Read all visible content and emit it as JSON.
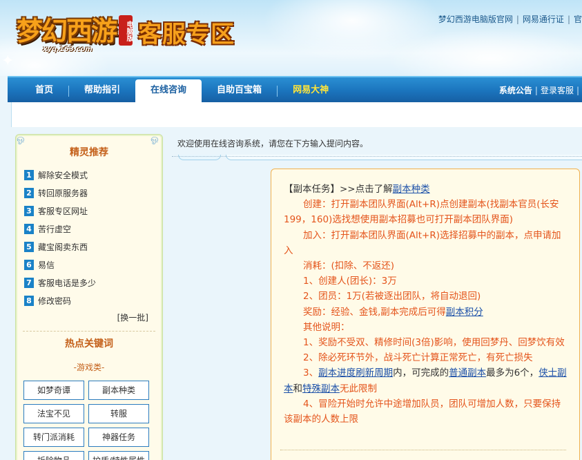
{
  "header": {
    "logo_game_text": "梦幻西游",
    "logo_edition": "电脑版",
    "logo_url": "xyq.163.com",
    "title": "客服专区",
    "top_links": [
      "梦幻西游电脑版官网",
      "网易通行证",
      "官"
    ]
  },
  "nav": {
    "items": [
      {
        "label": "首页"
      },
      {
        "label": "帮助指引"
      },
      {
        "label": "在线咨询"
      },
      {
        "label": "自助百宝箱"
      },
      {
        "label": "网易大神"
      }
    ],
    "right": {
      "announcement": "系统公告",
      "login": "登录客服",
      "more": "|"
    }
  },
  "sidebar": {
    "recommend_title": "精灵推荐",
    "recommend": [
      {
        "num": "1",
        "label": "解除安全模式"
      },
      {
        "num": "2",
        "label": "转回原服务器"
      },
      {
        "num": "3",
        "label": "客服专区网址"
      },
      {
        "num": "4",
        "label": "苦行虚空"
      },
      {
        "num": "5",
        "label": "藏宝阁卖东西"
      },
      {
        "num": "6",
        "label": "易信"
      },
      {
        "num": "7",
        "label": "客服电话是多少"
      },
      {
        "num": "8",
        "label": "修改密码"
      }
    ],
    "change_batch": "[换一批]",
    "hot_title": "热点关键词",
    "category": "-游戏类-",
    "keywords": [
      "如梦奇谭",
      "副本种类",
      "法宝不见",
      "转服",
      "转门派消耗",
      "神器任务",
      "拆除物品",
      "护盾/特性属性"
    ]
  },
  "main": {
    "welcome": "欢迎使用在线咨询系统，请您在下方输入提问内容。",
    "answer": {
      "l1_prefix": "【副本任务】>>点击了解",
      "l1_link": "副本种类",
      "l2": "创建：打开副本团队界面(Alt+R)点创建副本(找副本官员(长安199，160)选找想使用副本招募也可打开副本团队界面)",
      "l3": "加入：打开副本团队界面(Alt+R)选择招募中的副本，点申请加入",
      "l4": "消耗：(扣除、不返还)",
      "l5": "1、创建人(团长)：3万",
      "l6": "2、团员：1万(若被逐出团队，将自动退回)",
      "l7_prefix": "奖励：经验、金钱,副本完成后可得",
      "l7_link": "副本积分",
      "l8": "其他说明：",
      "l9": "1、奖励不受双、精修时间(3倍)影响，使用回梦丹、回梦饮有效",
      "l10": "2、除必死环节外，战斗死亡计算正常死亡，有死亡损失",
      "l11_a": "3、",
      "l11_link1": "副本进度刷新周期",
      "l11_b": "内，可完成的",
      "l11_link2": "普通副本",
      "l11_c": "最多为6个，",
      "l11_link3": "侠士副本",
      "l11_d": "和",
      "l11_link4": "特殊副本",
      "l11_e": "无此限制",
      "l12": "4、冒险开始时允许中途增加队员，团队可增加人数，只要保持该副本的人数上限"
    }
  },
  "colors": {
    "nav_blue": "#1b74bd",
    "accent_orange": "#c4601a",
    "answer_text": "#e4541b",
    "link_blue": "#1a4fa8",
    "nav_highlight": "#ffe53a"
  }
}
